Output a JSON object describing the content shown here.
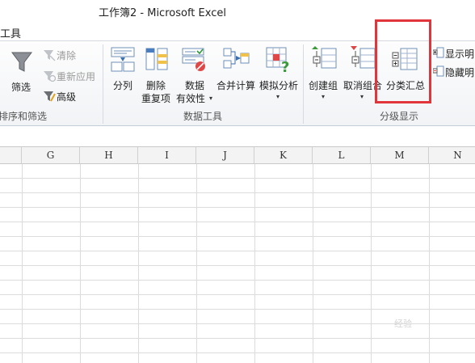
{
  "title": "工作簿2  -  Microsoft Excel",
  "menu_tab": "工具",
  "ribbon": {
    "sort_filter": {
      "filter": "筛选",
      "clear": "清除",
      "reapply": "重新应用",
      "advanced": "高级",
      "group_label": "排序和筛选"
    },
    "data_tools": {
      "split": "分列",
      "remove_dup_1": "删除",
      "remove_dup_2": "重复项",
      "validation_1": "数据",
      "validation_2": "有效性",
      "consolidate": "合并计算",
      "whatif": "模拟分析",
      "group_label": "数据工具"
    },
    "outline": {
      "group": "创建组",
      "ungroup": "取消组合",
      "subtotal": "分类汇总",
      "show_detail": "显示明",
      "hide_detail": "隐藏明",
      "group_label": "分级显示"
    }
  },
  "columns": [
    "G",
    "H",
    "I",
    "J",
    "K",
    "L",
    "M",
    "N"
  ],
  "watermark": "经验"
}
